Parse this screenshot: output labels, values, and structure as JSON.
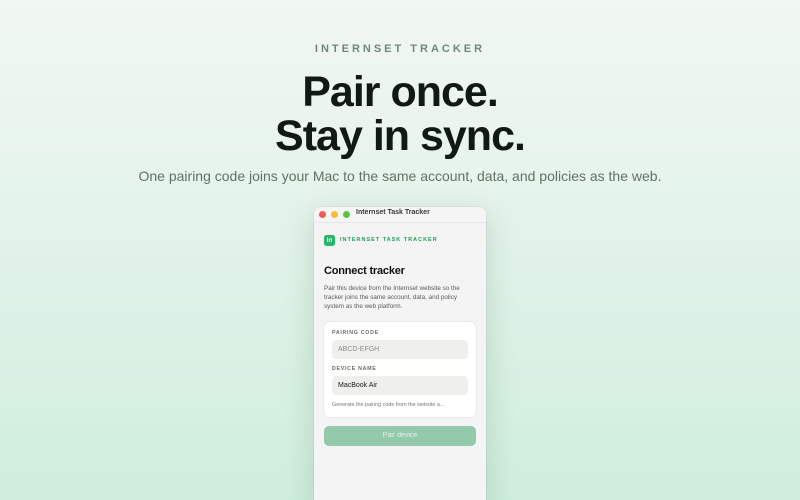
{
  "hero": {
    "eyebrow": "INTERNSET TRACKER",
    "headline_line1": "Pair once.",
    "headline_line2": "Stay in sync.",
    "subhead": "One pairing code joins your Mac to the same account, data, and policies as the web."
  },
  "window": {
    "title": "Internset Task Tracker",
    "brand_text": "INTERNSET TASK TRACKER",
    "logo_glyph": "in",
    "heading": "Connect tracker",
    "description": "Pair this device from the Internset website so the tracker joins the same account, data, and policy system as the web platform.",
    "pairing_code": {
      "label": "PAIRING CODE",
      "placeholder": "ABCD-EFGH",
      "value": ""
    },
    "device_name": {
      "label": "DEVICE NAME",
      "value": "MacBook Air"
    },
    "hint": "Generate the pairing code from the website a...",
    "pair_button_label": "Pair device"
  },
  "colors": {
    "accent": "#2bb56b",
    "brand_text": "#1f9e5a",
    "button_disabled": "#94c9ab",
    "traffic_close": "#ee5e58",
    "traffic_minimize": "#f3bd3a",
    "traffic_maximize": "#5ec148"
  },
  "icons": {
    "logo": "internset-logo-icon"
  }
}
